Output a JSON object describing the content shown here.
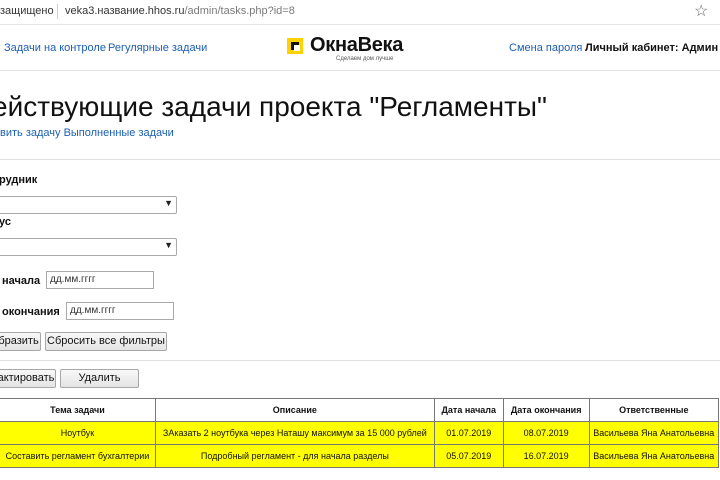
{
  "browser": {
    "security_text": "защищено",
    "url_host": "veka3.название.hhos.ru",
    "url_path": "/admin/tasks.php?id=8",
    "bookmark_glyph": "☆"
  },
  "header": {
    "nav_left": [
      "Задачи на контроле",
      "Регулярные задачи"
    ],
    "logo_text": "ОкнаВека",
    "logo_tagline": "Сделаем дом лучше",
    "change_password": "Смена пароля",
    "cabinet_label": "Личный кабинет: Админ"
  },
  "page": {
    "title": "ействующие задачи проекта \"Регламенты\"",
    "links": [
      "вить задачу",
      "Выполненные задачи"
    ]
  },
  "filters": {
    "employee_label": "рудник",
    "status_label": "ус",
    "start_label": "начала",
    "start_placeholder": "дд.мм.гггг",
    "end_label": "окончания",
    "end_placeholder": "дд.мм.гггг",
    "apply_button": "бразить",
    "reset_button": "Сбросить все фильтры"
  },
  "actions": {
    "edit_button": "актировать",
    "delete_button": "Удалить"
  },
  "table": {
    "headers": [
      "Тема задачи",
      "Описание",
      "Дата начала",
      "Дата окончания",
      "Ответственные"
    ],
    "rows": [
      [
        "Ноутбук",
        "ЗАказать 2 ноутбука через Наташу максимум за 15 000 рублей",
        "01.07.2019",
        "08.07.2019",
        "Васильева Яна Анатольевна"
      ],
      [
        "Составить регламент бухгалтерии",
        "Подробный регламент - для начала разделы",
        "05.07.2019",
        "16.07.2019",
        "Васильева Яна Анатольевна"
      ]
    ]
  },
  "colors": {
    "row_highlight": "#ffff00",
    "logo_accent": "#ffd200",
    "link": "#1c5fb1"
  }
}
